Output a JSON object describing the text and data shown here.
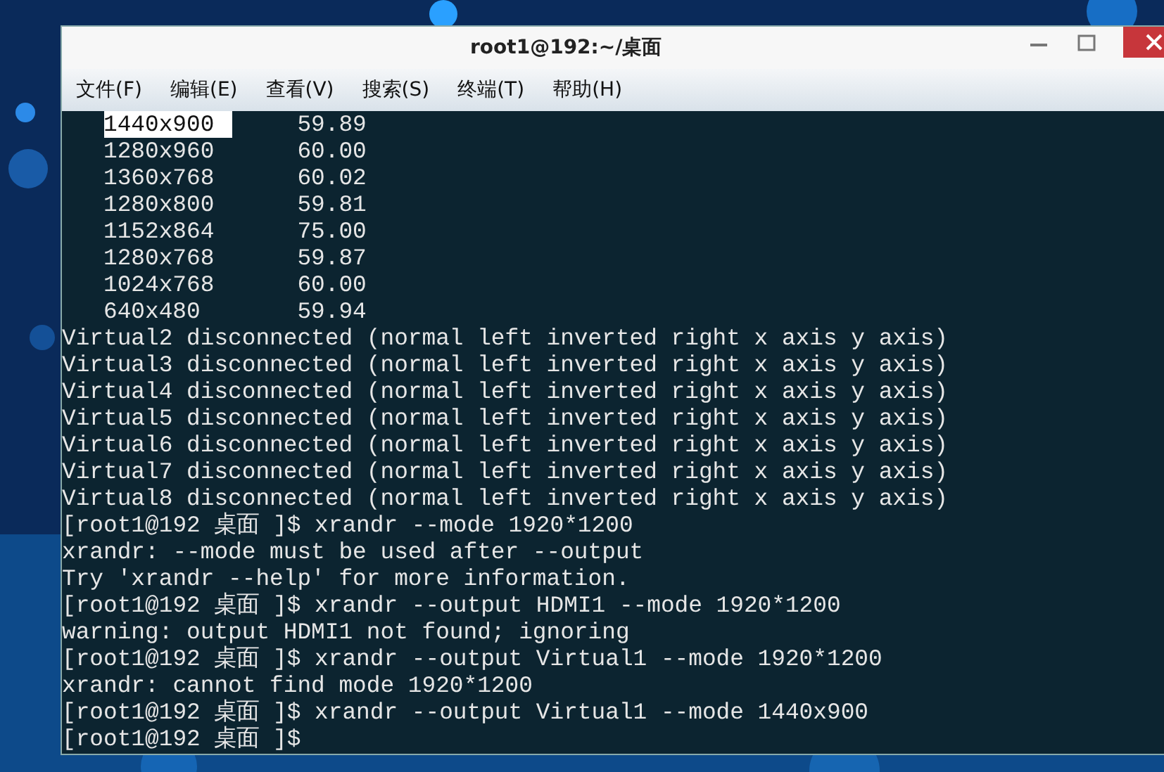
{
  "window": {
    "title": "root1@192:~/桌面"
  },
  "menu": [
    "文件(F)",
    "编辑(E)",
    "查看(V)",
    "搜索(S)",
    "终端(T)",
    "帮助(H)"
  ],
  "terminal": [
    {
      "kind": "mode",
      "mode": "1440x900",
      "rate": "59.89",
      "selected": true
    },
    {
      "kind": "mode",
      "mode": "1280x960",
      "rate": "60.00",
      "selected": false
    },
    {
      "kind": "mode",
      "mode": "1360x768",
      "rate": "60.02",
      "selected": false
    },
    {
      "kind": "mode",
      "mode": "1280x800",
      "rate": "59.81",
      "selected": false
    },
    {
      "kind": "mode",
      "mode": "1152x864",
      "rate": "75.00",
      "selected": false
    },
    {
      "kind": "mode",
      "mode": "1280x768",
      "rate": "59.87",
      "selected": false
    },
    {
      "kind": "mode",
      "mode": "1024x768",
      "rate": "60.00",
      "selected": false
    },
    {
      "kind": "mode",
      "mode": "640x480",
      "rate": "59.94",
      "selected": false
    },
    {
      "kind": "output",
      "text": "Virtual2 disconnected (normal left inverted right x axis y axis)"
    },
    {
      "kind": "output",
      "text": "Virtual3 disconnected (normal left inverted right x axis y axis)"
    },
    {
      "kind": "output",
      "text": "Virtual4 disconnected (normal left inverted right x axis y axis)"
    },
    {
      "kind": "output",
      "text": "Virtual5 disconnected (normal left inverted right x axis y axis)"
    },
    {
      "kind": "output",
      "text": "Virtual6 disconnected (normal left inverted right x axis y axis)"
    },
    {
      "kind": "output",
      "text": "Virtual7 disconnected (normal left inverted right x axis y axis)"
    },
    {
      "kind": "output",
      "text": "Virtual8 disconnected (normal left inverted right x axis y axis)"
    },
    {
      "kind": "prompt",
      "prompt": "[root1@192 桌面 ]$",
      "command": "xrandr --mode 1920*1200"
    },
    {
      "kind": "output",
      "text": "xrandr: --mode must be used after --output"
    },
    {
      "kind": "output",
      "text": "Try 'xrandr --help' for more information."
    },
    {
      "kind": "prompt",
      "prompt": "[root1@192 桌面 ]$",
      "command": "xrandr --output HDMI1 --mode 1920*1200"
    },
    {
      "kind": "output",
      "text": "warning: output HDMI1 not found; ignoring"
    },
    {
      "kind": "prompt",
      "prompt": "[root1@192 桌面 ]$",
      "command": "xrandr --output Virtual1 --mode 1920*1200"
    },
    {
      "kind": "output",
      "text": "xrandr: cannot find mode 1920*1200"
    },
    {
      "kind": "prompt",
      "prompt": "[root1@192 桌面 ]$",
      "command": "xrandr --output Virtual1 --mode 1440x900"
    },
    {
      "kind": "prompt",
      "prompt": "[root1@192 桌面 ]$"
    }
  ]
}
